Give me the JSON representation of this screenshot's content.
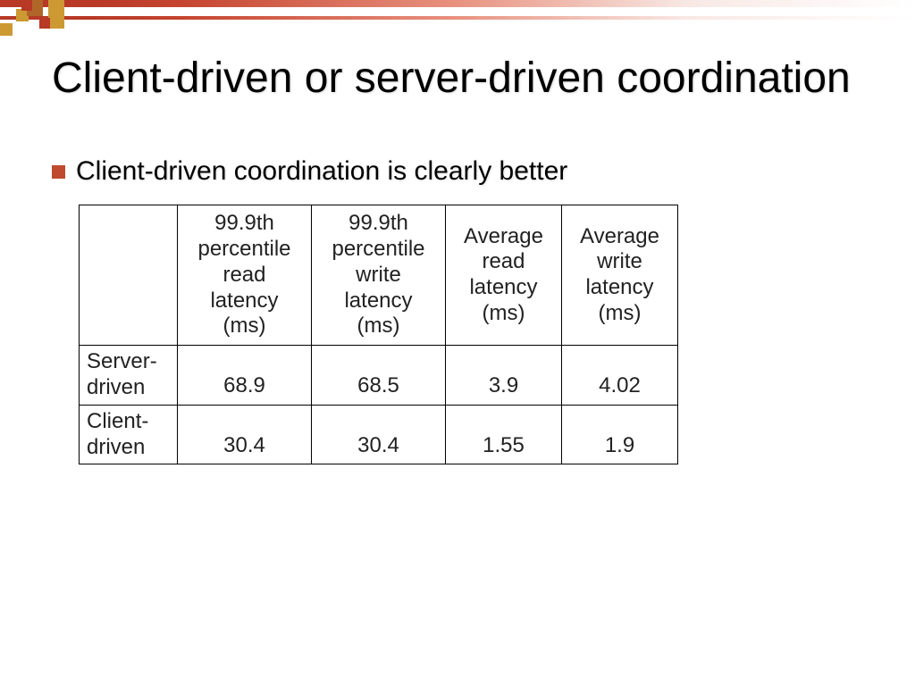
{
  "title": "Client-driven or server-driven coordination",
  "bullet": "Client-driven coordination is clearly better",
  "table": {
    "headers": [
      "",
      "99.9th percentile read latency (ms)",
      "99.9th percentile write latency (ms)",
      "Average read latency (ms)",
      "Average write latency (ms)"
    ],
    "rows": [
      {
        "label": "Server-driven",
        "values": [
          "68.9",
          "68.5",
          "3.9",
          "4.02"
        ]
      },
      {
        "label": "Client-driven",
        "values": [
          "30.4",
          "30.4",
          "1.55",
          "1.9"
        ]
      }
    ]
  },
  "chart_data": {
    "type": "table",
    "title": "Client-driven or server-driven coordination",
    "columns": [
      "",
      "99.9th percentile read latency (ms)",
      "99.9th percentile write latency (ms)",
      "Average read latency (ms)",
      "Average write latency (ms)"
    ],
    "rows": [
      [
        "Server-driven",
        68.9,
        68.5,
        3.9,
        4.02
      ],
      [
        "Client-driven",
        30.4,
        30.4,
        1.55,
        1.9
      ]
    ]
  }
}
